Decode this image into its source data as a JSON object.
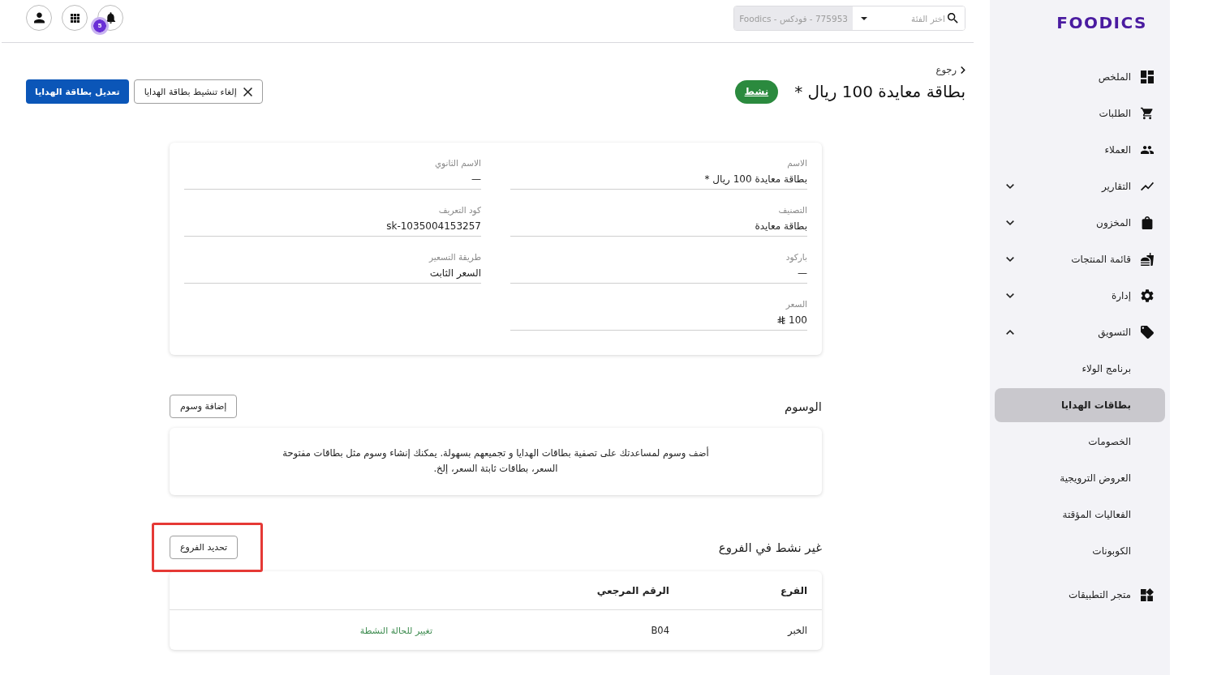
{
  "topbar": {
    "branch_picker": {
      "placeholder": "اختر الفئة",
      "account": "775953 - فودكس - Foodics"
    },
    "notifications_count": "5"
  },
  "sidebar": {
    "logo": "FOODICS",
    "items": [
      {
        "label": "الملخص",
        "kind": "link",
        "selected": false
      },
      {
        "label": "الطلبات",
        "kind": "link",
        "selected": false
      },
      {
        "label": "العملاء",
        "kind": "link",
        "selected": false
      },
      {
        "label": "التقارير",
        "kind": "group",
        "expanded": false,
        "selected": false
      },
      {
        "label": "المخزون",
        "kind": "group",
        "expanded": false,
        "selected": false
      },
      {
        "label": "قائمة المنتجات",
        "kind": "group",
        "expanded": false,
        "selected": false
      },
      {
        "label": "إدارة",
        "kind": "group",
        "expanded": false,
        "selected": false
      },
      {
        "label": "التسويق",
        "kind": "group",
        "expanded": true,
        "selected": false,
        "children": [
          {
            "label": "برنامج الولاء",
            "selected": false
          },
          {
            "label": "بطاقات الهدايا",
            "selected": true
          },
          {
            "label": "الخصومات",
            "selected": false
          },
          {
            "label": "العروض الترويجية",
            "selected": false
          },
          {
            "label": "الفعاليات المؤقتة",
            "selected": false
          },
          {
            "label": "الكوبونات",
            "selected": false
          }
        ]
      },
      {
        "label": "متجر التطبيقات",
        "kind": "link",
        "selected": false
      }
    ]
  },
  "page": {
    "back": "رجوع",
    "title": "بطاقة معايدة 100 ريال *",
    "status": {
      "label": "نشط",
      "kind": "active"
    },
    "actions": [
      {
        "label": "إلغاء تنشيط بطاقة الهدايا",
        "kind": "secondary"
      },
      {
        "label": "تعديل بطاقة الهدايا",
        "kind": "primary"
      }
    ]
  },
  "details": {
    "fields": [
      {
        "label": "الاسم",
        "value": "بطاقة معايدة 100 ريال *",
        "kind": "text"
      },
      {
        "label": "الاسم الثانوي",
        "value": "—",
        "kind": "text"
      },
      {
        "label": "التصنيف",
        "value": "بطاقة معايدة",
        "kind": "text"
      },
      {
        "label": "كود التعريف",
        "value": "sk-1035004153257",
        "kind": "text"
      },
      {
        "label": "باركود",
        "value": "—",
        "kind": "text"
      },
      {
        "label": "طريقة التسعير",
        "value": "السعر الثابت",
        "kind": "text"
      },
      {
        "label": "السعر",
        "value": "100",
        "kind": "money"
      }
    ]
  },
  "tags": {
    "title": "الوسوم",
    "add_button": "إضافة وسوم",
    "empty_message": "أضف وسوم لمساعدتك على تصفية بطاقات الهدايا و تجميعهم بسهولة. يمكنك إنشاء وسوم مثل بطاقات مفتوحة السعر، بطاقات ثابتة السعر، إلخ."
  },
  "branches": {
    "title": "غير نشط في الفروع",
    "select_button": {
      "label": "تحديد الفروع",
      "highlighted": true
    },
    "table": {
      "columns": [
        "الفرع",
        "الرقم المرجعي"
      ],
      "rows": [
        {
          "cells": [
            "الخبر",
            "B04"
          ],
          "action": "تغيير للحالة النشطة"
        }
      ]
    }
  }
}
